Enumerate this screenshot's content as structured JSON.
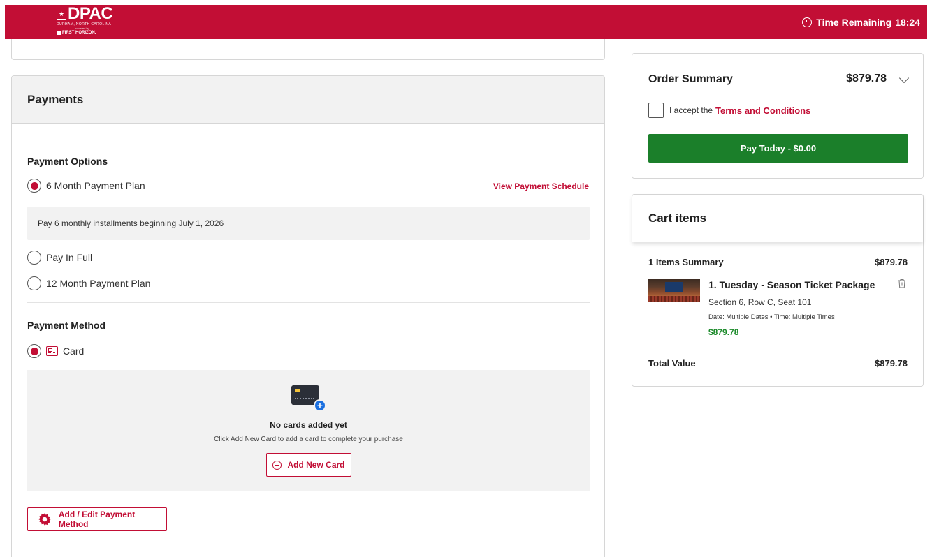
{
  "header": {
    "logo_text": "DPAC",
    "logo_subtitle": "DURHAM, NORTH CAROLINA",
    "logo_powered": "powered by",
    "logo_sponsor": "FIRST HORIZON.",
    "timer_label": "Time Remaining",
    "timer_value": "18:24"
  },
  "payments": {
    "title": "Payments",
    "options_title": "Payment Options",
    "options": [
      {
        "label": "6 Month Payment Plan",
        "selected": true
      },
      {
        "label": "Pay In Full",
        "selected": false
      },
      {
        "label": "12 Month Payment Plan",
        "selected": false
      }
    ],
    "view_schedule_link": "View Payment Schedule",
    "plan_info": "Pay 6 monthly installments beginning July 1, 2026",
    "method_title": "Payment Method",
    "method_card_label": "Card",
    "no_cards_title": "No cards added yet",
    "no_cards_subtitle": "Click Add New Card to add a card to complete your purchase",
    "add_card_label": "Add New Card",
    "edit_method_label": "Add / Edit Payment Method"
  },
  "order_summary": {
    "title": "Order Summary",
    "total": "$879.78",
    "accept_prefix": "I accept the",
    "terms_link": "Terms and Conditions",
    "pay_button": "Pay Today - $0.00"
  },
  "cart": {
    "title": "Cart items",
    "summary_label": "1 Items Summary",
    "summary_price": "$879.78",
    "item": {
      "name": "1. Tuesday - Season Ticket Package",
      "seat": "Section 6, Row C, Seat 101",
      "date": "Date: Multiple Dates • Time: Multiple Times",
      "price": "$879.78"
    },
    "total_label": "Total Value",
    "total_price": "$879.78"
  },
  "colors": {
    "brand": "#c20e35",
    "pay_button": "#1b7f2a",
    "price_green": "#1b8a2a",
    "panel_gray": "#f2f2f2"
  },
  "icons": [
    "clock-icon",
    "card-icon",
    "credit-card-add-icon",
    "plus-circle-icon",
    "gear-icon",
    "chevron-down-icon",
    "trash-icon"
  ]
}
